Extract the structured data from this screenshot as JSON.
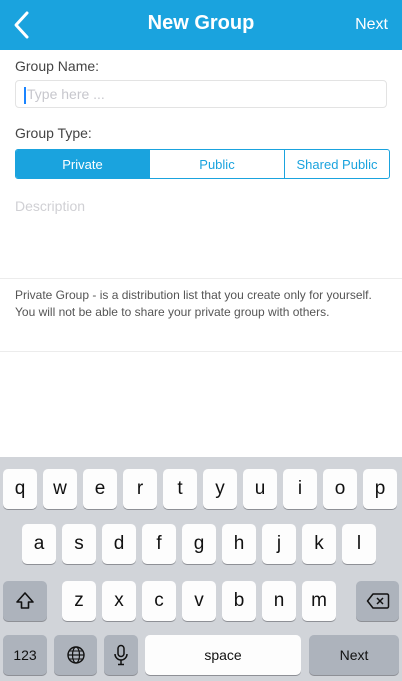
{
  "nav": {
    "title": "New Group",
    "next": "Next"
  },
  "form": {
    "name_label": "Group Name:",
    "name_placeholder": "Type here ...",
    "type_label": "Group Type:",
    "types": [
      "Private",
      "Public",
      "Shared Public"
    ],
    "selected_type": "Private",
    "description_placeholder": "Description",
    "help_text": "Private Group - is a distribution list that you create only for yourself. You will not be able to share your private group with others."
  },
  "keyboard": {
    "row1": [
      "q",
      "w",
      "e",
      "r",
      "t",
      "y",
      "u",
      "i",
      "o",
      "p"
    ],
    "row2": [
      "a",
      "s",
      "d",
      "f",
      "g",
      "h",
      "j",
      "k",
      "l"
    ],
    "row3": [
      "z",
      "x",
      "c",
      "v",
      "b",
      "n",
      "m"
    ],
    "numbers_key": "123",
    "space_key": "space",
    "return_key": "Next"
  },
  "colors": {
    "accent": "#1aa3de",
    "keyboard_bg": "#d1d4d9"
  }
}
